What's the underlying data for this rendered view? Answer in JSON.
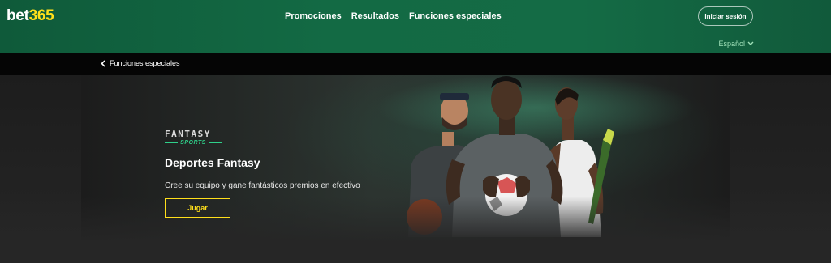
{
  "brand": {
    "name_main": "bet",
    "name_accent": "365",
    "accent_color": "#ffdf1b",
    "header_color": "#146b45"
  },
  "nav": {
    "items": [
      "Promociones",
      "Resultados",
      "Funciones especiales"
    ]
  },
  "header": {
    "login_label": "Iniciar sesión",
    "language": "Español"
  },
  "breadcrumb": {
    "back_label": "Funciones especiales"
  },
  "hero": {
    "logo_word": "FANTASY",
    "logo_sub": "SPORTS",
    "title": "Deportes Fantasy",
    "subtitle": "Cree su equipo y gane fantásticos premios en efectivo",
    "cta_label": "Jugar"
  },
  "icons": {
    "back": "chevron-left-icon",
    "language": "chevron-down-icon"
  }
}
